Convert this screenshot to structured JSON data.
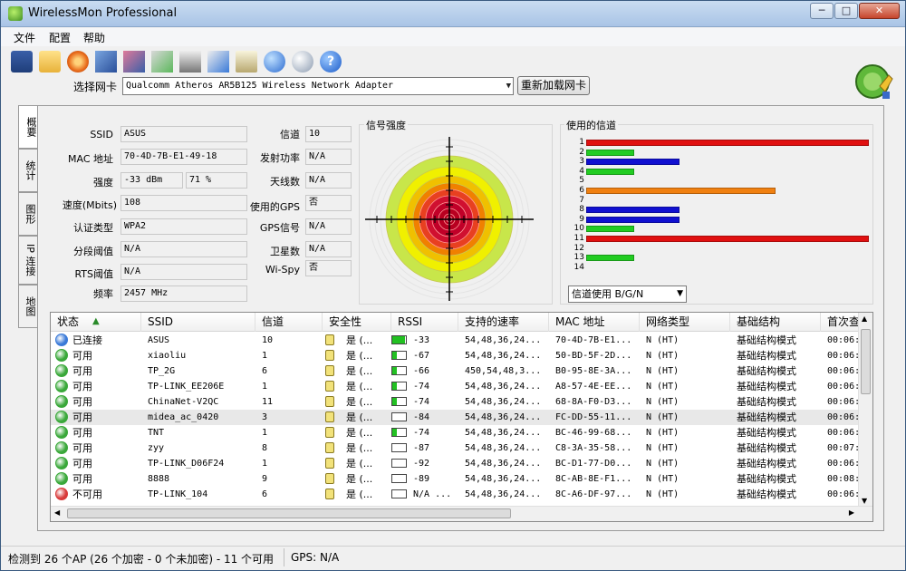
{
  "window": {
    "title": "WirelessMon Professional",
    "controls": {
      "minimize": "─",
      "maximize": "□",
      "close": "✕"
    }
  },
  "menu": [
    "文件",
    "配置",
    "帮助"
  ],
  "toolbar": {
    "icons": [
      "save-icon",
      "open-folder-icon",
      "disc-icon",
      "network-icon",
      "network-settings-icon",
      "run-icon",
      "print-icon",
      "export-icon",
      "clipboard-icon",
      "globe-icon",
      "connect-icon",
      "help-icon"
    ]
  },
  "adapter": {
    "label": "选择网卡",
    "selected": "Qualcomm Atheros AR5B125 Wireless Network Adapter",
    "reload_button": "重新加载网卡"
  },
  "tabs": [
    "概要",
    "统计",
    "图形",
    "IP 连接",
    "地图"
  ],
  "summary": {
    "ssid": {
      "label": "SSID",
      "value": "ASUS"
    },
    "mac": {
      "label": "MAC 地址",
      "value": "70-4D-7B-E1-49-18"
    },
    "strength": {
      "label": "强度",
      "dbm": "-33 dBm",
      "percent": "71 %"
    },
    "speed": {
      "label": "速度(Mbits)",
      "value": "108"
    },
    "auth": {
      "label": "认证类型",
      "value": "WPA2"
    },
    "frag": {
      "label": "分段阈值",
      "value": "N/A"
    },
    "rts": {
      "label": "RTS阈值",
      "value": "N/A"
    },
    "freq": {
      "label": "频率",
      "value": "2457 MHz"
    },
    "channel": {
      "label": "信道",
      "value": "10"
    },
    "tx_power": {
      "label": "发射功率",
      "value": "N/A"
    },
    "antennas": {
      "label": "天线数",
      "value": "N/A"
    },
    "use_gps": {
      "label": "使用的GPS",
      "value": "否"
    },
    "gps_signal": {
      "label": "GPS信号",
      "value": "N/A"
    },
    "satellites": {
      "label": "卫星数",
      "value": "N/A"
    },
    "wispy": {
      "label": "Wi-Spy",
      "value": "否"
    }
  },
  "signal_panel": {
    "title": "信号强度",
    "ring_colors": [
      "#c8e64a",
      "#f0f000",
      "#f0c000",
      "#f08000",
      "#e84020",
      "#d01030",
      "#c00028",
      "#b80020"
    ]
  },
  "channels_panel": {
    "title": "使用的信道",
    "selector": "信道使用 B/G/N",
    "channels": [
      {
        "num": "1",
        "usage": 1.0,
        "color": "#e01010"
      },
      {
        "num": "2",
        "usage": 0.17,
        "color": "#22cc22"
      },
      {
        "num": "3",
        "usage": 0.33,
        "color": "#1010d0"
      },
      {
        "num": "4",
        "usage": 0.17,
        "color": "#22cc22"
      },
      {
        "num": "5",
        "usage": 0,
        "color": "#22cc22"
      },
      {
        "num": "6",
        "usage": 0.67,
        "color": "#f08010"
      },
      {
        "num": "7",
        "usage": 0,
        "color": "#22cc22"
      },
      {
        "num": "8",
        "usage": 0.33,
        "color": "#1010d0"
      },
      {
        "num": "9",
        "usage": 0.33,
        "color": "#1010d0"
      },
      {
        "num": "10",
        "usage": 0.17,
        "color": "#22cc22"
      },
      {
        "num": "11",
        "usage": 1.0,
        "color": "#e01010"
      },
      {
        "num": "12",
        "usage": 0,
        "color": "#22cc22"
      },
      {
        "num": "13",
        "usage": 0.17,
        "color": "#22cc22"
      },
      {
        "num": "14",
        "usage": 0,
        "color": "#22cc22"
      }
    ]
  },
  "table": {
    "headers": [
      "状态",
      "SSID",
      "信道",
      "安全性",
      "RSSI",
      "支持的速率",
      "MAC 地址",
      "网络类型",
      "基础结构",
      "首次查"
    ],
    "sort_indicator": "▲",
    "rows": [
      {
        "status": "已连接",
        "dot": "#3a7ad8",
        "ssid": "ASUS",
        "channel": "10",
        "security": "是 (...",
        "rssi": "-33",
        "rssi_level": 0.9,
        "rates": "54,48,36,24...",
        "mac": "70-4D-7B-E1...",
        "net_type": "N (HT)",
        "infra": "基础结构模式",
        "first": "00:06:",
        "selected": false
      },
      {
        "status": "可用",
        "dot": "#3aa83a",
        "ssid": "xiaoliu",
        "channel": "1",
        "security": "是 (...",
        "rssi": "-67",
        "rssi_level": 0.35,
        "rates": "54,48,36,24...",
        "mac": "50-BD-5F-2D...",
        "net_type": "N (HT)",
        "infra": "基础结构模式",
        "first": "00:06:",
        "selected": false
      },
      {
        "status": "可用",
        "dot": "#3aa83a",
        "ssid": "TP_2G",
        "channel": "6",
        "security": "是 (...",
        "rssi": "-66",
        "rssi_level": 0.35,
        "rates": "450,54,48,3...",
        "mac": "B0-95-8E-3A...",
        "net_type": "N (HT)",
        "infra": "基础结构模式",
        "first": "00:06:",
        "selected": false
      },
      {
        "status": "可用",
        "dot": "#3aa83a",
        "ssid": "TP-LINK_EE206E",
        "channel": "1",
        "security": "是 (...",
        "rssi": "-74",
        "rssi_level": 0.3,
        "rates": "54,48,36,24...",
        "mac": "A8-57-4E-EE...",
        "net_type": "N (HT)",
        "infra": "基础结构模式",
        "first": "00:06:",
        "selected": false
      },
      {
        "status": "可用",
        "dot": "#3aa83a",
        "ssid": "ChinaNet-V2QC",
        "channel": "11",
        "security": "是 (...",
        "rssi": "-74",
        "rssi_level": 0.3,
        "rates": "54,48,36,24...",
        "mac": "68-8A-F0-D3...",
        "net_type": "N (HT)",
        "infra": "基础结构模式",
        "first": "00:06:",
        "selected": false
      },
      {
        "status": "可用",
        "dot": "#3aa83a",
        "ssid": "midea_ac_0420",
        "channel": "3",
        "security": "是 (...",
        "rssi": "-84",
        "rssi_level": 0,
        "rates": "54,48,36,24...",
        "mac": "FC-DD-55-11...",
        "net_type": "N (HT)",
        "infra": "基础结构模式",
        "first": "00:06:",
        "selected": true
      },
      {
        "status": "可用",
        "dot": "#3aa83a",
        "ssid": "TNT",
        "channel": "1",
        "security": "是 (...",
        "rssi": "-74",
        "rssi_level": 0.3,
        "rates": "54,48,36,24...",
        "mac": "BC-46-99-68...",
        "net_type": "N (HT)",
        "infra": "基础结构模式",
        "first": "00:06:",
        "selected": false
      },
      {
        "status": "可用",
        "dot": "#3aa83a",
        "ssid": "zyy",
        "channel": "8",
        "security": "是 (...",
        "rssi": "-87",
        "rssi_level": 0,
        "rates": "54,48,36,24...",
        "mac": "C8-3A-35-58...",
        "net_type": "N (HT)",
        "infra": "基础结构模式",
        "first": "00:07:",
        "selected": false
      },
      {
        "status": "可用",
        "dot": "#3aa83a",
        "ssid": "TP-LINK_D06F24",
        "channel": "1",
        "security": "是 (...",
        "rssi": "-92",
        "rssi_level": 0,
        "rates": "54,48,36,24...",
        "mac": "BC-D1-77-D0...",
        "net_type": "N (HT)",
        "infra": "基础结构模式",
        "first": "00:06:",
        "selected": false
      },
      {
        "status": "可用",
        "dot": "#3aa83a",
        "ssid": "8888",
        "channel": "9",
        "security": "是 (...",
        "rssi": "-89",
        "rssi_level": 0,
        "rates": "54,48,36,24...",
        "mac": "8C-AB-8E-F1...",
        "net_type": "N (HT)",
        "infra": "基础结构模式",
        "first": "00:08:",
        "selected": false
      },
      {
        "status": "不可用",
        "dot": "#d83a3a",
        "ssid": "TP-LINK_104",
        "channel": "6",
        "security": "是 (...",
        "rssi": "N/A ...",
        "rssi_level": 0,
        "rates": "54,48,36,24...",
        "mac": "8C-A6-DF-97...",
        "net_type": "N (HT)",
        "infra": "基础结构模式",
        "first": "00:06:",
        "selected": false
      }
    ]
  },
  "statusbar": {
    "ap_summary": "检测到 26 个AP (26 个加密 - 0 个未加密) - 11 个可用",
    "gps": "GPS: N/A"
  }
}
